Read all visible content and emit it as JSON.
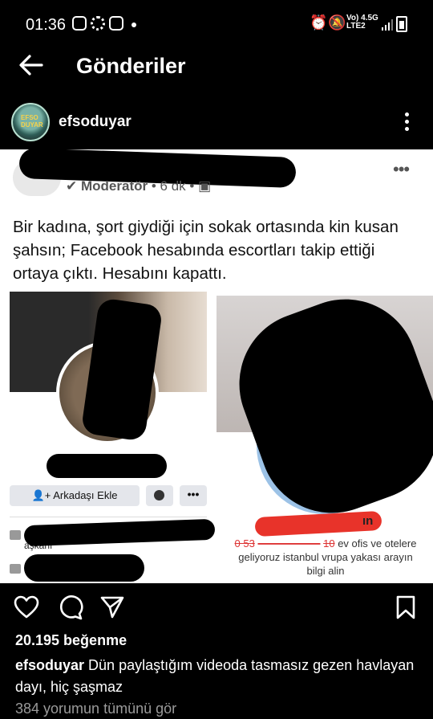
{
  "status_bar": {
    "time": "01:36",
    "network_top": "Vo) 4.5G",
    "network_bottom": "LTE2"
  },
  "header": {
    "title": "Gönderiler"
  },
  "post": {
    "username": "efsoduyar",
    "avatar_text": "EFSO DUYAR",
    "screenshot": {
      "role": "Moderatör",
      "time": "6 dk",
      "caption": "Bir kadına, şort giydiği için sokak ortasında kin kusan şahsın; Facebook hesabında escortları takip ettiği ortaya çıktı. Hesabını kapattı.",
      "add_friend_label": "Arkadaşı Ekle",
      "more_label": "•••",
      "work_label": "aşkanı",
      "ad_text_hidden": "0 53",
      "ad_text_struck": "10",
      "ad_text": "ev ofis ve otelere geliyoruz istanbul vrupa yakası arayın bilgi alin",
      "ad_name_fragment": "ın"
    },
    "likes": "20.195 beğenme",
    "description_user": "efsoduyar",
    "description_text": "Dün paylaştığım videoda tasmasız gezen havlayan dayı, hiç şaşmaz",
    "comments_link": "384 yorumun tümünü gör"
  },
  "colors": {
    "background": "#000000",
    "text": "#ffffff",
    "muted": "#9a9a9a",
    "redaction": "#e8332a"
  }
}
